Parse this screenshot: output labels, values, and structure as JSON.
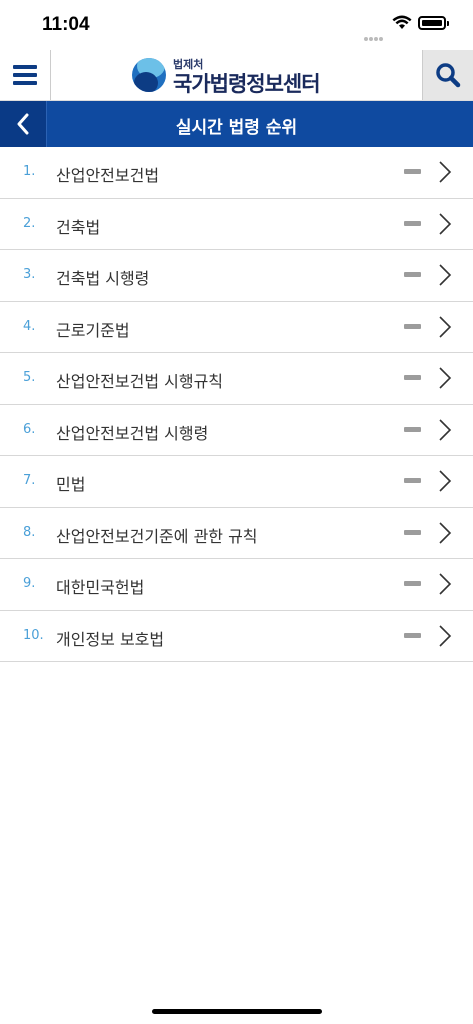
{
  "status_bar": {
    "time": "11:04"
  },
  "header": {
    "logo_small": "법제처",
    "logo_big": "국가법령정보센터",
    "menu_icon": "hamburger-icon",
    "search_icon": "search-icon"
  },
  "titlebar": {
    "title": "실시간 법령 순위",
    "back_icon": "chevron-left-icon"
  },
  "list": {
    "items": [
      {
        "rank": "1.",
        "name": "산업안전보건법"
      },
      {
        "rank": "2.",
        "name": "건축법"
      },
      {
        "rank": "3.",
        "name": "건축법 시행령"
      },
      {
        "rank": "4.",
        "name": "근로기준법"
      },
      {
        "rank": "5.",
        "name": "산업안전보건법 시행규칙"
      },
      {
        "rank": "6.",
        "name": "산업안전보건법 시행령"
      },
      {
        "rank": "7.",
        "name": "민법"
      },
      {
        "rank": "8.",
        "name": "산업안전보건기준에 관한 규칙"
      },
      {
        "rank": "9.",
        "name": "대한민국헌법"
      },
      {
        "rank": "10.",
        "name": "개인정보 보호법"
      }
    ]
  },
  "colors": {
    "brand_blue": "#0f4aa0",
    "rank_blue": "#4ba0d8",
    "search_bg": "#e6e6e6"
  }
}
